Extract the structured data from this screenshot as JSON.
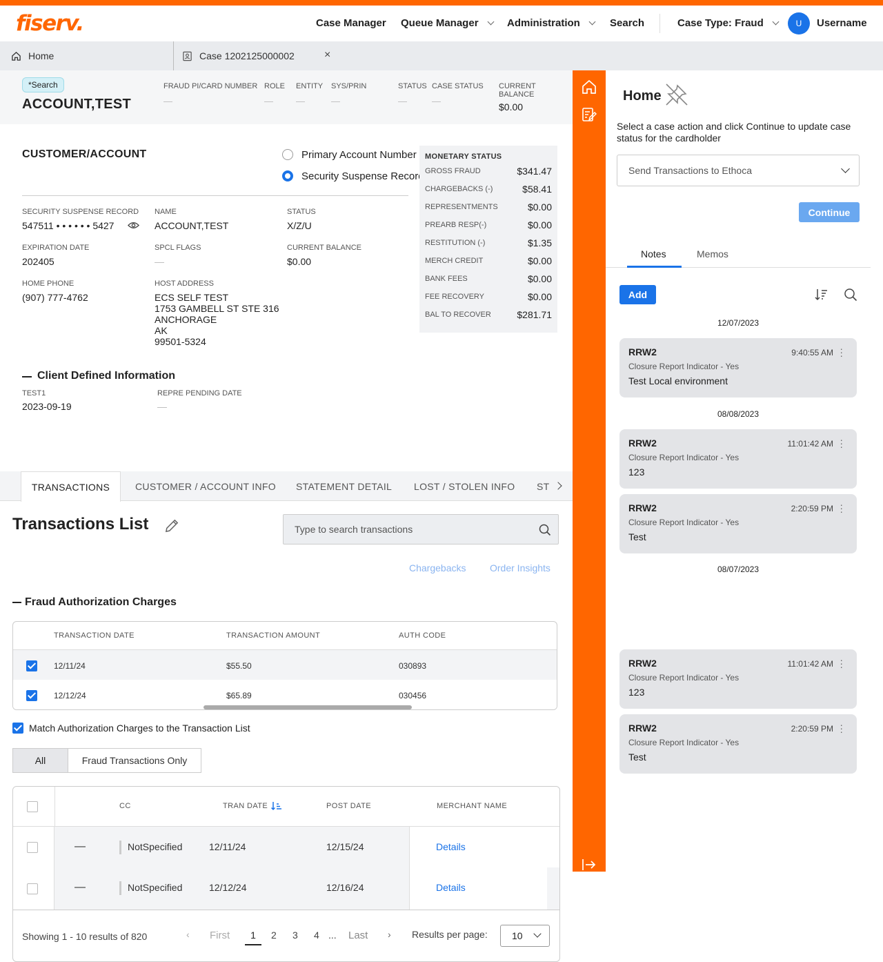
{
  "header": {
    "logo": "fiserv.",
    "nav": [
      "Case Manager",
      "Queue Manager",
      "Administration",
      "Search"
    ],
    "case_type": "Case Type: Fraud",
    "avatar_initial": "U",
    "username": "Username"
  },
  "tabs": {
    "home": "Home",
    "case": "Case 1202125000002",
    "close": "×"
  },
  "summary": {
    "chip": "*Search",
    "account_name": "ACCOUNT,TEST",
    "columns": [
      {
        "label": "FRAUD PI/CARD NUMBER",
        "value": "—"
      },
      {
        "label": "ROLE",
        "value": "—"
      },
      {
        "label": "ENTITY",
        "value": "—"
      },
      {
        "label": "SYS/PRIN",
        "value": "—"
      },
      {
        "label": "STATUS",
        "value": "—"
      },
      {
        "label": "CASE STATUS",
        "value": "—"
      },
      {
        "label": "CURRENT BALANCE",
        "value": "$0.00"
      }
    ]
  },
  "customer": {
    "title": "CUSTOMER/ACCOUNT",
    "radio_pan": "Primary Account Number",
    "radio_ssr": "Security Suspense Record",
    "fields": {
      "ssr_label": "SECURITY SUSPENSE RECORD",
      "ssr_value": "547511 • • • • • • 5427",
      "name_label": "NAME",
      "name_value": "ACCOUNT,TEST",
      "status_label": "STATUS",
      "status_value": "X/Z/U",
      "exp_label": "EXPIRATION DATE",
      "exp_value": "202405",
      "spcl_label": "SPCL FLAGS",
      "spcl_value": "—",
      "bal_label": "CURRENT BALANCE",
      "bal_value": "$0.00",
      "phone_label": "HOME PHONE",
      "phone_value": "(907) 777-4762",
      "addr_label": "HOST ADDRESS",
      "addr_lines": [
        "ECS SELF TEST",
        "1753 GAMBELL ST STE 316",
        "ANCHORAGE",
        "AK",
        "99501-5324"
      ]
    },
    "client_defined": {
      "title": "Client Defined Information",
      "test1_label": "TEST1",
      "test1_value": "2023-09-19",
      "repre_label": "REPRE PENDING DATE",
      "repre_value": "—"
    }
  },
  "monetary": {
    "title": "MONETARY STATUS",
    "rows": [
      {
        "label": "GROSS FRAUD",
        "value": "$341.47"
      },
      {
        "label": "CHARGEBACKS (-)",
        "value": "$58.41"
      },
      {
        "label": "REPRESENTMENTS",
        "value": "$0.00"
      },
      {
        "label": "PREARB RESP(-)",
        "value": "$0.00"
      },
      {
        "label": "RESTITUTION (-)",
        "value": "$1.35"
      },
      {
        "label": "MERCH CREDIT",
        "value": "$0.00"
      },
      {
        "label": "BANK FEES",
        "value": "$0.00"
      },
      {
        "label": "FEE RECOVERY",
        "value": "$0.00"
      },
      {
        "label": "BAL TO RECOVER",
        "value": "$281.71"
      }
    ]
  },
  "subtabs": [
    "TRANSACTIONS",
    "CUSTOMER / ACCOUNT INFO",
    "STATEMENT DETAIL",
    "LOST / STOLEN INFO",
    "ST"
  ],
  "transactions": {
    "title": "Transactions List",
    "search_placeholder": "Type to search transactions",
    "chargebacks": "Chargebacks",
    "order_insights": "Order Insights",
    "fraud_auth_title": "Fraud Authorization Charges",
    "auth_headers": [
      "TRANSACTION DATE",
      "TRANSACTION AMOUNT",
      "AUTH CODE"
    ],
    "auth_rows": [
      {
        "date": "12/11/24",
        "amount": "$55.50",
        "code": "030893"
      },
      {
        "date": "12/12/24",
        "amount": "$65.89",
        "code": "030456"
      }
    ],
    "match_label": "Match Authorization Charges to the Transaction List",
    "filter_all": "All",
    "filter_fraud": "Fraud Transactions Only",
    "list_headers": [
      "CC",
      "TRAN DATE",
      "POST DATE",
      "MERCHANT NAME"
    ],
    "list_rows": [
      {
        "dash": "—",
        "cc": "NotSpecified",
        "tran": "12/11/24",
        "post": "12/15/24",
        "merchant": "Details"
      },
      {
        "dash": "—",
        "cc": "NotSpecified",
        "tran": "12/12/24",
        "post": "12/16/24",
        "merchant": "Details"
      }
    ],
    "pagination": {
      "showing": "Showing 1 - 10 results of 820",
      "first": "First",
      "pages": [
        "1",
        "2",
        "3",
        "4"
      ],
      "ellipsis": "...",
      "last": "Last",
      "rpp_label": "Results per page:",
      "rpp_value": "10"
    }
  },
  "sidepanel": {
    "title": "Home",
    "instruction": "Select a case action and click Continue to update case status for the cardholder",
    "action_select": "Send Transactions to Ethoca",
    "continue": "Continue",
    "tab_notes": "Notes",
    "tab_memos": "Memos",
    "add": "Add",
    "groups": [
      {
        "date": "12/07/2023",
        "notes": [
          {
            "who": "RRW2",
            "time": "9:40:55 AM",
            "sub": "Closure Report Indicator - Yes",
            "text": "Test Local environment"
          }
        ]
      },
      {
        "date": "08/08/2023",
        "notes": [
          {
            "who": "RRW2",
            "time": "11:01:42 AM",
            "sub": "Closure Report Indicator - Yes",
            "text": "123"
          },
          {
            "who": "RRW2",
            "time": "2:20:59 PM",
            "sub": "Closure Report Indicator - Yes",
            "text": "Test"
          }
        ]
      },
      {
        "date": "08/07/2023",
        "notes": [
          {
            "who": "RRW2",
            "time": "11:01:42 AM",
            "sub": "Closure Report Indicator - Yes",
            "text": "123"
          },
          {
            "who": "RRW2",
            "time": "2:20:59 PM",
            "sub": "Closure Report Indicator - Yes",
            "text": "Test"
          }
        ]
      }
    ]
  },
  "colors": {
    "brand": "#ff6600",
    "accent": "#1a73e8"
  }
}
